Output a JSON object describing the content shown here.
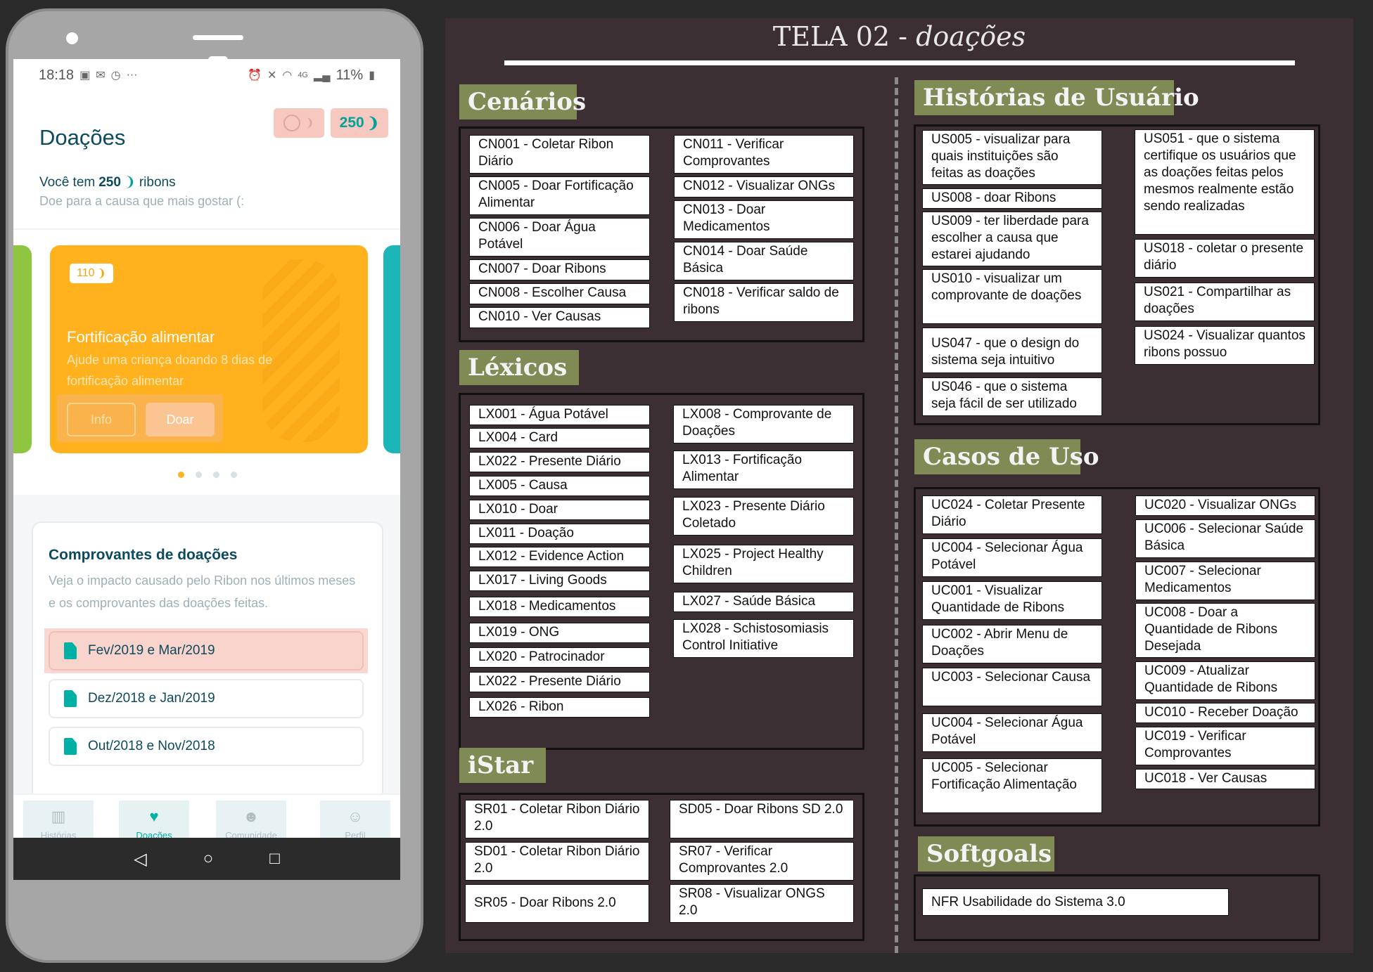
{
  "phone": {
    "status": {
      "time": "18:18",
      "battery": "11%",
      "network": "4G"
    },
    "title": "Doações",
    "balance": "250",
    "you_have_prefix": "Você tem",
    "you_have_amount": "250",
    "you_have_suffix": "ribons",
    "tagline": "Doe para a causa que mais gostar (:",
    "card": {
      "badge": "110",
      "title": "Fortificação alimentar",
      "description": "Ajude uma criança doando 8 dias de fortificação alimentar",
      "info_label": "Info",
      "donate_label": "Doar"
    },
    "receipts": {
      "title": "Comprovantes de doações",
      "description": "Veja o impacto causado pelo Ribon nos últimos meses e os comprovantes das doações feitas.",
      "items": [
        "Fev/2019 e Mar/2019",
        "Dez/2018 e Jan/2019",
        "Out/2018 e Nov/2018"
      ]
    },
    "tabs": [
      "Histórias",
      "Doações",
      "Comunidade",
      "Perfil"
    ]
  },
  "board": {
    "title_main": "TELA 02 - ",
    "title_em": "doações",
    "sections": {
      "cenarios": "Cenários",
      "lexicos": "Léxicos",
      "istar": "iStar",
      "historias": "Histórias de Usuário",
      "casos": "Casos de Uso",
      "softgoals": "Softgoals"
    },
    "cenarios": [
      "CN001 - Coletar Ribon Diário",
      "CN005 - Doar Fortificação Alimentar",
      "CN006 - Doar Água Potável",
      "CN007 - Doar Ribons",
      "CN008 - Escolher Causa",
      "CN010 - Ver Causas",
      "CN011 - Verificar Comprovantes",
      "CN012 - Visualizar ONGs",
      "CN013 - Doar Medicamentos",
      "CN014 - Doar Saúde Básica",
      "CN018 - Verificar saldo de ribons"
    ],
    "lexicos": [
      "LX001 - Água Potável",
      "LX004 - Card",
      "LX022 - Presente Diário",
      "LX005 - Causa",
      "LX010 - Doar",
      "LX011 - Doação",
      "LX012 - Evidence Action",
      "LX017 - Living Goods",
      "LX018 - Medicamentos",
      "LX019 - ONG",
      "LX020 - Patrocinador",
      "LX022 - Presente Diário",
      "LX026 - Ribon",
      "LX008 - Comprovante de Doações",
      "LX013 - Fortificação Alimentar",
      "LX023 - Presente Diário Coletado",
      "LX025 - Project Healthy Children",
      "LX027 - Saúde Básica",
      "LX028 - Schistosomiasis Control Initiative"
    ],
    "istar": [
      "SR01 - Coletar Ribon Diário 2.0",
      "SD01 - Coletar Ribon Diário 2.0",
      "SR05 - Doar Ribons 2.0",
      "SD05 - Doar Ribons SD 2.0",
      "SR07 - Verificar Comprovantes 2.0",
      "SR08 - Visualizar ONGS 2.0"
    ],
    "historias": [
      "US005 - visualizar para quais instituições são feitas as doações",
      "US008 - doar Ribons",
      "US009 - ter liberdade para escolher a causa que estarei ajudando",
      "US010 - visualizar um comprovante de doações",
      "US047 - que o design do sistema seja intuitivo",
      "US046 - que o sistema seja fácil de ser utilizado",
      "US051 - que o sistema certifique os usuários que as doações feitas pelos mesmos realmente estão sendo realizadas",
      "US018 - coletar o presente diário",
      "US021 - Compartilhar as doações",
      "US024 - Visualizar quantos ribons possuo"
    ],
    "casos": [
      "UC024 - Coletar Presente Diário",
      "UC004 - Selecionar Água Potável",
      "UC001 - Visualizar Quantidade de Ribons",
      "UC002 - Abrir Menu de Doações",
      "UC003 - Selecionar Causa",
      "UC004 - Selecionar Água Potável",
      "UC005 - Selecionar Fortificação Alimentação",
      "UC020 - Visualizar ONGs",
      "UC006 - Selecionar Saúde Básica",
      "UC007 - Selecionar Medicamentos",
      "UC008 - Doar a Quantidade de Ribons Desejada",
      "UC009 - Atualizar Quantidade de Ribons",
      "UC010 - Receber Doação",
      "UC019 - Verificar Comprovantes",
      "UC018 - Ver Causas"
    ],
    "softgoals": [
      "NFR Usabilidade do Sistema 3.0"
    ]
  }
}
